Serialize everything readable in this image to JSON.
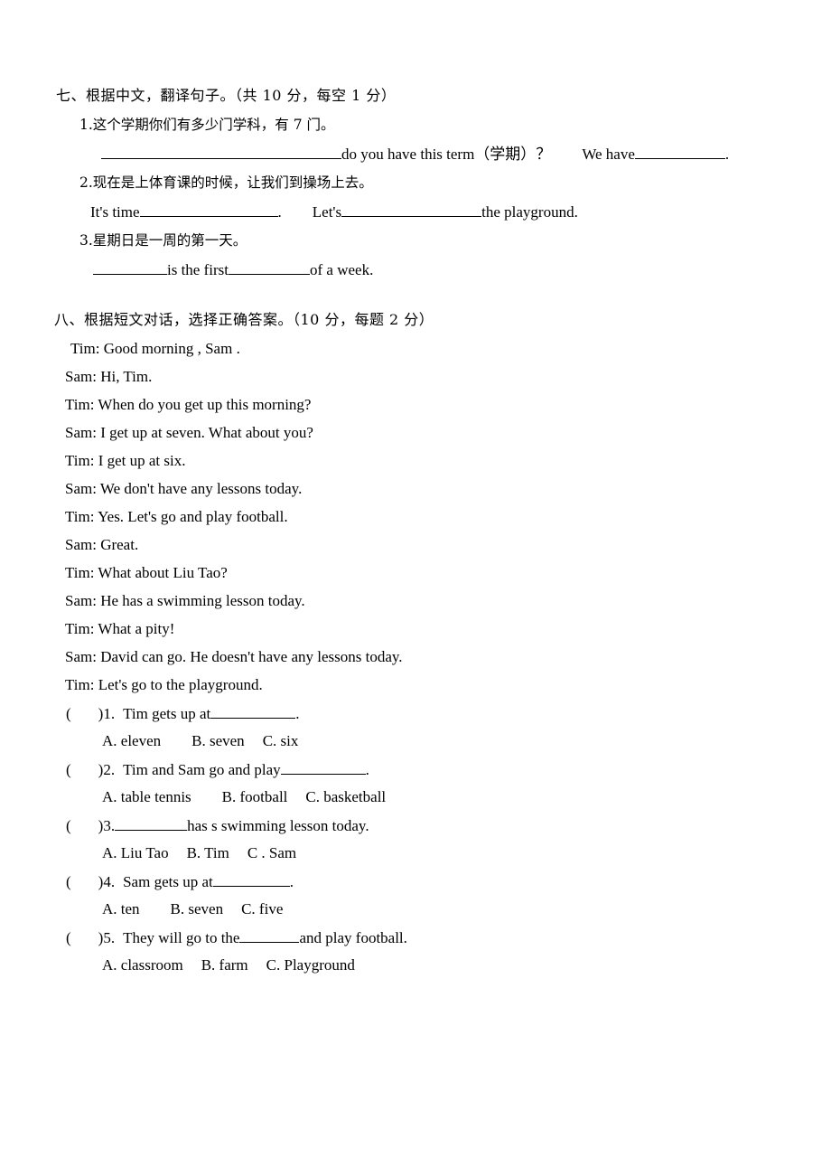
{
  "document": {
    "type": "english-exam-worksheet",
    "page_background": "#ffffff",
    "text_color": "#000000"
  },
  "section_seven": {
    "heading": "七、根据中文，翻译句子。（共 10 分，每空 1 分）",
    "items": [
      {
        "number": "1.",
        "chinese_prompt": "1.这个学期你们有多少门学科，有 7 门。",
        "answer_line": {
          "blank_1_width": 266,
          "text_after_blank_1": "do you have this term（学期）？",
          "text_2": "We have",
          "blank_2_width": 100,
          "text_end": "."
        }
      },
      {
        "number": "2.",
        "chinese_prompt": "2.现在是上体育课的时候，让我们到操场上去。",
        "answer_line": {
          "text_1": "It's time",
          "blank_1_width": 153,
          "text_mid": ".",
          "text_2": "Let's",
          "blank_2_width": 155,
          "text_end": "the playground."
        }
      },
      {
        "number": "3.",
        "chinese_prompt": "3.星期日是一周的第一天。",
        "answer_line": {
          "blank_1_width": 82,
          "text_1": "is the first",
          "blank_2_width": 90,
          "text_end": "of a week."
        }
      }
    ]
  },
  "section_eight": {
    "heading": "八、根据短文对话，选择正确答案。（10 分，每题 2 分）",
    "dialogue": [
      "Tim: Good morning , Sam .",
      "Sam: Hi, Tim.",
      "Tim: When do you get up this morning?",
      "Sam: I get up at seven. What about you?",
      "Tim: I get up at six.",
      "Sam: We don't have any lessons today.",
      "Tim: Yes. Let's go and play football.",
      "Sam: Great.",
      "Tim: What about Liu Tao?",
      "Sam: He has a swimming lesson today.",
      "Tim: What a pity!",
      "Sam: David can go. He doesn't have any lessons today.",
      "Tim: Let's go to the playground."
    ],
    "questions": [
      {
        "marker_open": "(",
        "marker_close": ")",
        "number": "1.",
        "stem_before": "Tim gets up at",
        "blank_width": 94,
        "stem_after": ".",
        "options": [
          "A. eleven",
          "B. seven",
          "C. six"
        ]
      },
      {
        "marker_open": "(",
        "marker_close": ")",
        "number": "2.",
        "stem_before": "Tim and Sam go and play",
        "blank_width": 94,
        "stem_after": ".",
        "options": [
          "A. table tennis",
          "B. football",
          "C. basketball"
        ]
      },
      {
        "marker_open": "(",
        "marker_close": ")",
        "number": "3.",
        "stem_before": "",
        "blank_width": 80,
        "stem_after": "has s swimming lesson today.",
        "options": [
          "A. Liu Tao",
          "B. Tim",
          "C . Sam"
        ]
      },
      {
        "marker_open": "(",
        "marker_close": ")",
        "number": "4.",
        "stem_before": "Sam gets up at",
        "blank_width": 85,
        "stem_after": ".",
        "options": [
          "A. ten",
          "B. seven",
          "C. five"
        ]
      },
      {
        "marker_open": "(",
        "marker_close": ")",
        "number": "5.",
        "stem_before": "They will go to the",
        "blank_width": 66,
        "stem_after": "and play football.",
        "options": [
          "A. classroom",
          "B. farm",
          "C. Playground"
        ]
      }
    ]
  }
}
